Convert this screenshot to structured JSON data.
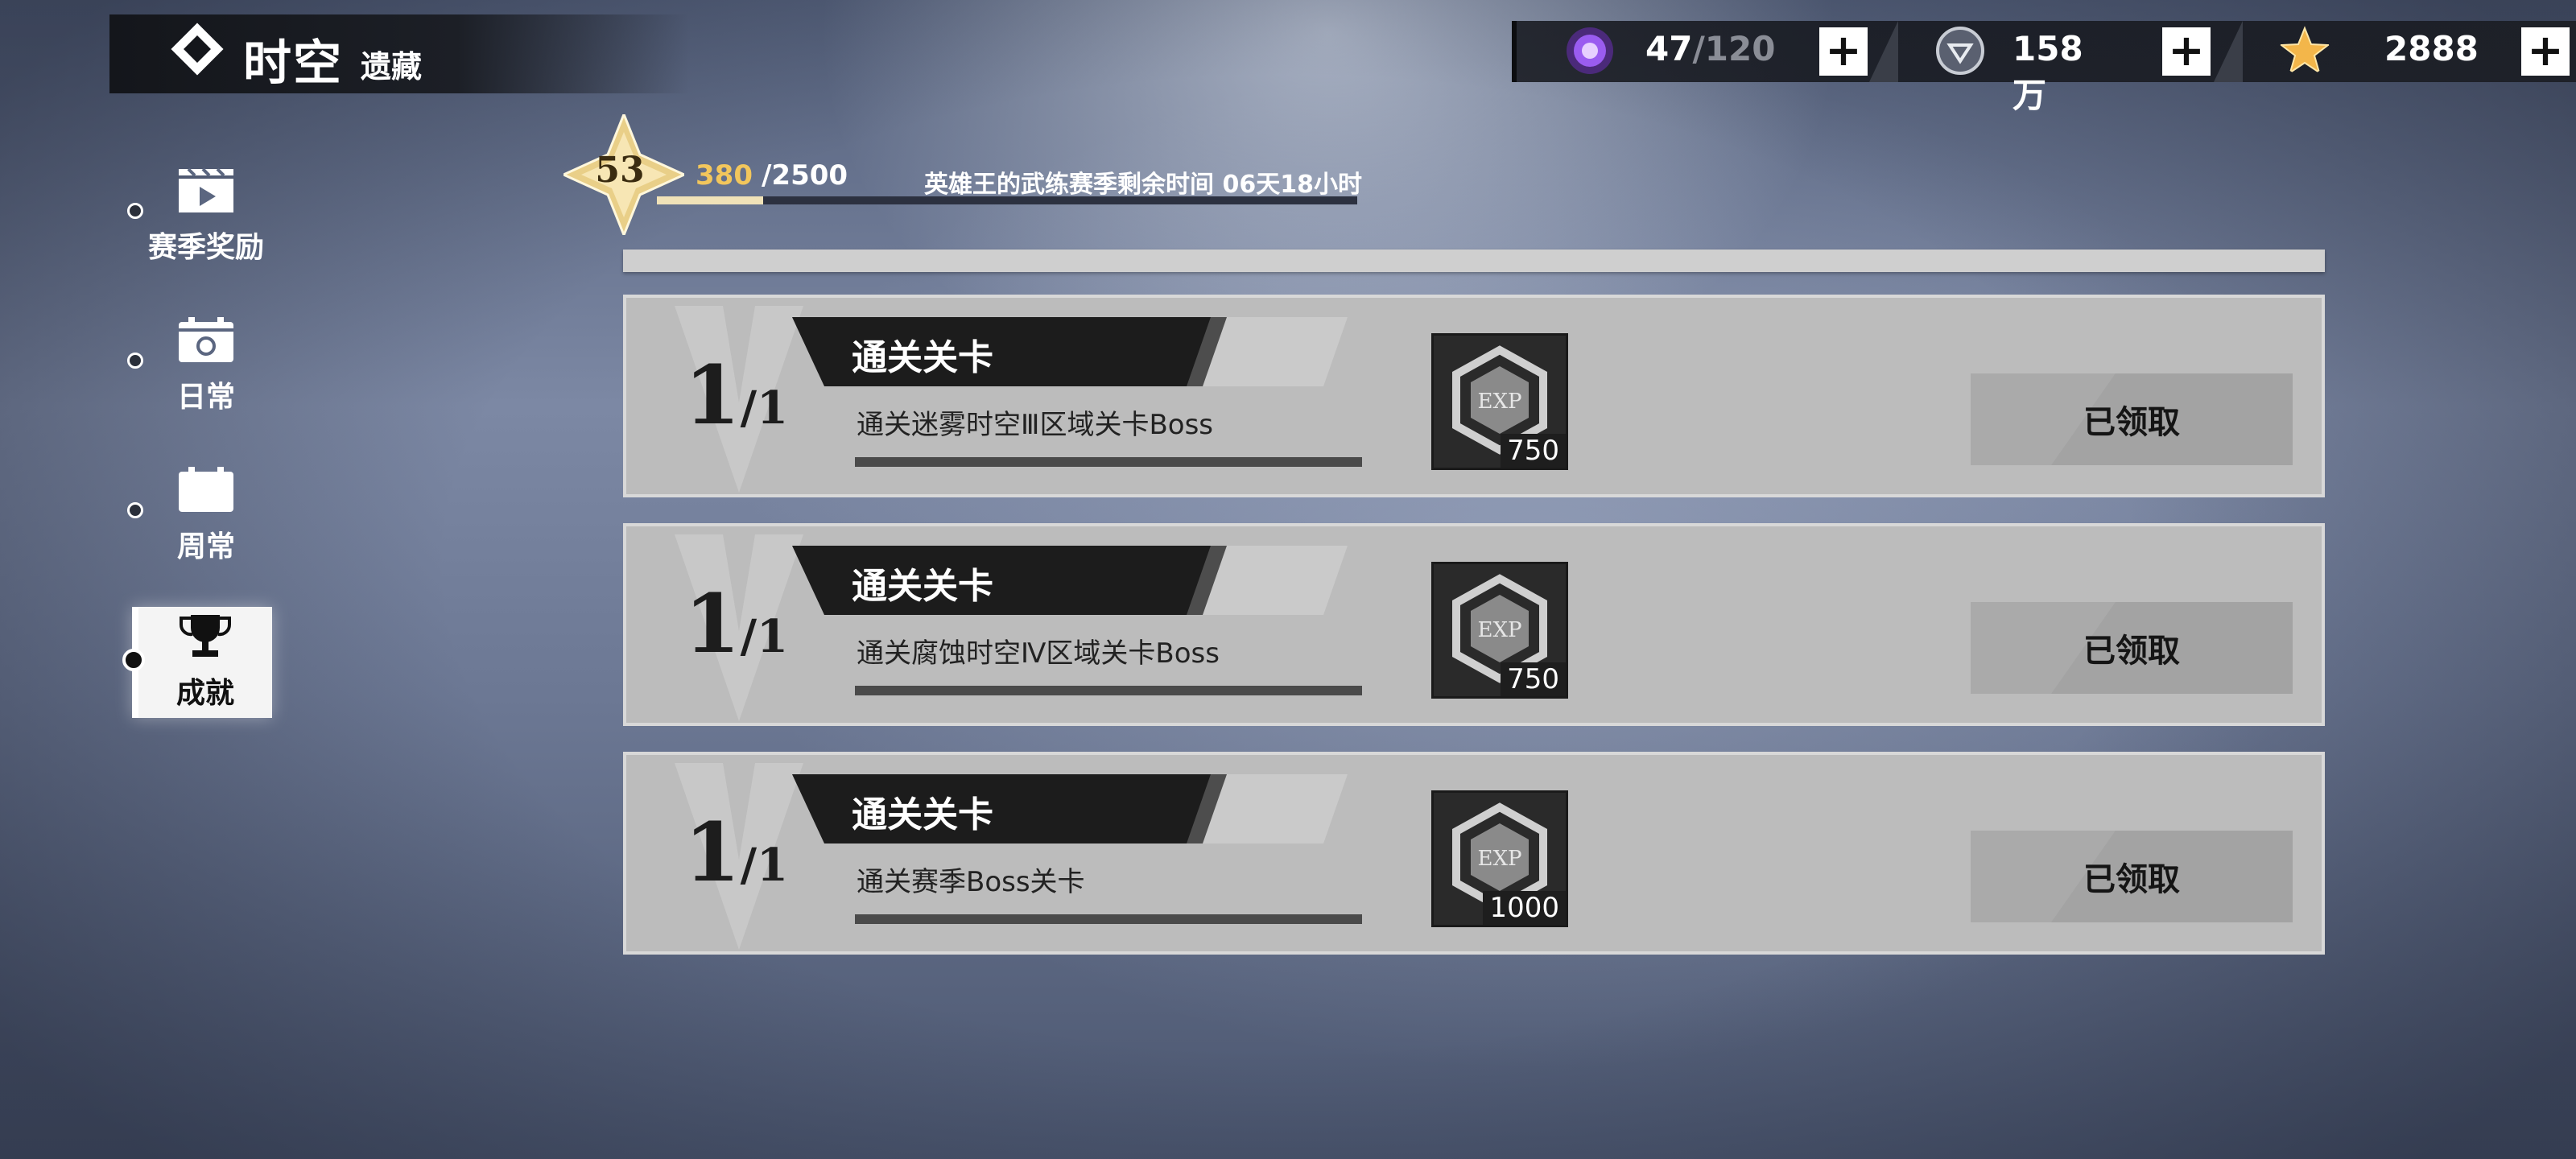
{
  "header": {
    "title_main": "时空",
    "title_sub": "遗藏"
  },
  "currencies": [
    {
      "icon": "purple-orb-icon",
      "value": "47",
      "max": "/120"
    },
    {
      "icon": "silver-coin-icon",
      "value": "158万"
    },
    {
      "icon": "gold-star-icon",
      "value": "2888"
    }
  ],
  "nav": [
    {
      "label": "赛季奖励",
      "icon": "clapperboard-icon",
      "active": false
    },
    {
      "label": "日常",
      "icon": "daily-calendar-icon",
      "active": false
    },
    {
      "label": "周常",
      "icon": "weekly-calendar-icon",
      "active": false
    },
    {
      "label": "成就",
      "icon": "trophy-icon",
      "active": true
    }
  ],
  "level": {
    "level": "53",
    "current": "380",
    "max": "/2500",
    "progress_fraction": 0.152,
    "season_text": "英雄王的武练赛季剩余时间 06天18小时"
  },
  "tasks": [
    {
      "progress": "1",
      "total": "/1",
      "title": "通关关卡",
      "desc": "通关迷雾时空Ⅲ区域关卡Boss",
      "reward_icon": "exp-icon",
      "reward_label": "EXP",
      "reward_qty": "750",
      "button": "已领取"
    },
    {
      "progress": "1",
      "total": "/1",
      "title": "通关关卡",
      "desc": "通关腐蚀时空Ⅳ区域关卡Boss",
      "reward_icon": "exp-icon",
      "reward_label": "EXP",
      "reward_qty": "750",
      "button": "已领取"
    },
    {
      "progress": "1",
      "total": "/1",
      "title": "通关关卡",
      "desc": "通关赛季Boss关卡",
      "reward_icon": "exp-icon",
      "reward_label": "EXP",
      "reward_qty": "1000",
      "button": "已领取"
    }
  ],
  "colors": {
    "accent_gold": "#f2c65c",
    "panel": "#bcbcbc",
    "banner": "#1c1c1c"
  }
}
